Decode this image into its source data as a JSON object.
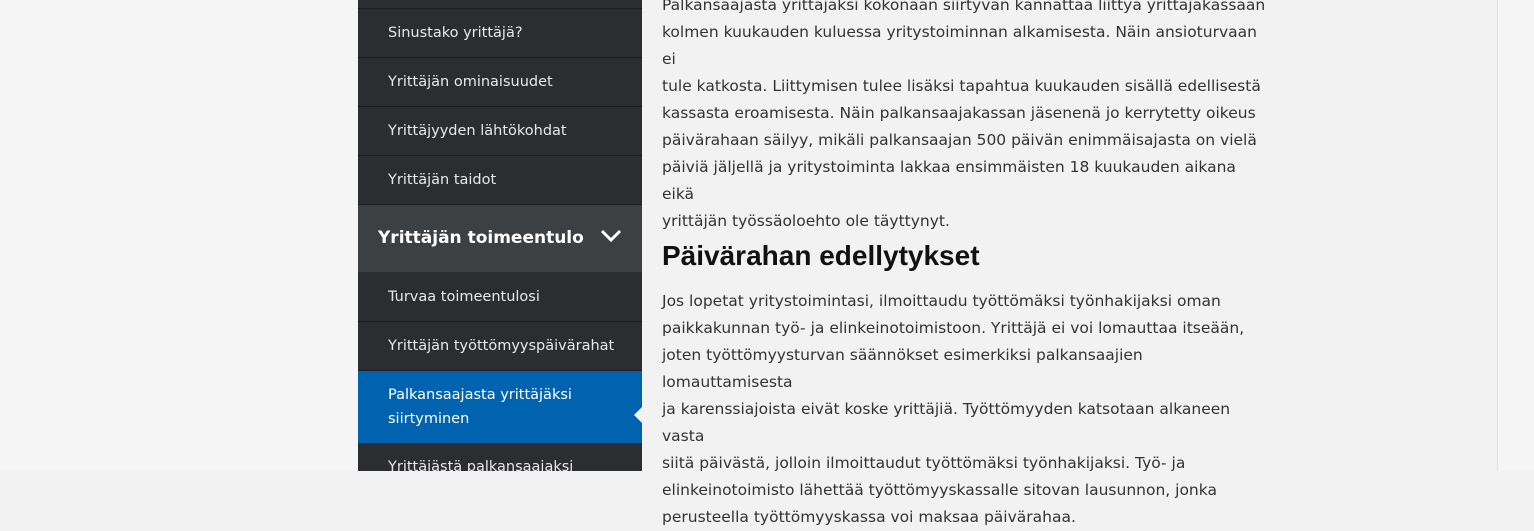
{
  "sidebar": {
    "items_top": [
      {
        "label": "Sinustako yrittäjä?"
      },
      {
        "label": "Yrittäjän ominaisuudet"
      },
      {
        "label": "Yrittäjyyden lähtökohdat"
      },
      {
        "label": "Yrittäjän taidot"
      }
    ],
    "section": {
      "label": "Yrittäjän toimeentulo",
      "icon": "chevron-down-icon",
      "expanded": true
    },
    "sub_items": [
      {
        "label": "Turvaa toimeentulosi"
      },
      {
        "label": "Yrittäjän työttömyyspäivärahat"
      },
      {
        "label_line1": "Palkansaajasta yrittäjäksi",
        "label_line2": "siirtyminen",
        "active": true
      },
      {
        "label": "Yrittäjästä palkansaajaksi"
      }
    ],
    "active_color": "#0063b0"
  },
  "main": {
    "para1_lines": [
      "Palkansaajasta yrittäjäksi kokonaan siirtyvän kannattaa liittyä yrittäjäkassaan",
      "kolmen kuukauden kuluessa yritystoiminnan alkamisesta. Näin ansioturvaan ei",
      "tule katkosta. Liittymisen tulee lisäksi tapahtua kuukauden sisällä edellisestä",
      "kassasta eroamisesta. Näin palkansaajakassan jäsenenä jo kerrytetty oikeus",
      "päivärahaan säilyy, mikäli palkansaajan 500 päivän enimmäisajasta on vielä",
      "päiviä jäljellä ja yritystoiminta lakkaa ensimmäisten 18 kuukauden aikana eikä",
      "yrittäjän työssäoloehto ole täyttynyt."
    ],
    "heading": "Päivärahan edellytykset",
    "para2_lines": [
      "Jos lopetat yritystoimintasi, ilmoittaudu työttömäksi työnhakijaksi oman",
      "paikkakunnan työ- ja elinkeinotoimistoon. Yrittäjä ei voi lomauttaa itseään,",
      "joten työttömyysturvan säännökset esimerkiksi palkansaajien lomauttamisesta",
      "ja karenssiajoista eivät koske yrittäjiä. Työttömyyden katsotaan alkaneen vasta",
      "siitä päivästä, jolloin ilmoittaudut työttömäksi työnhakijaksi. Työ- ja",
      "elinkeinotoimisto lähettää työttömyyskassalle sitovan lausunnon, jonka",
      "perusteella työttömyyskassa voi maksaa päivärahaa."
    ]
  }
}
